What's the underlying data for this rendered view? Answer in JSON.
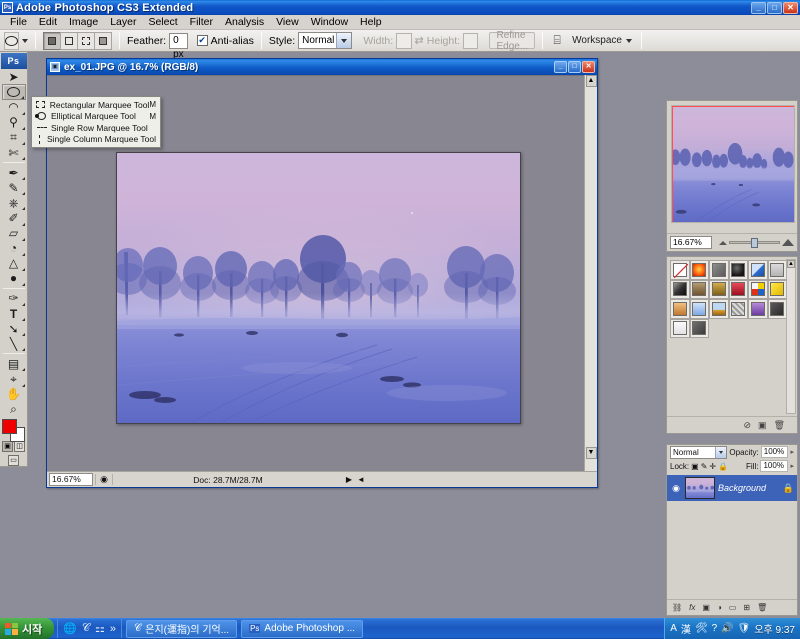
{
  "window": {
    "title": "Adobe Photoshop CS3 Extended",
    "app_icon": "photoshop-icon",
    "minimize": "_",
    "maximize": "□",
    "close": "✕"
  },
  "menubar": {
    "items": [
      {
        "label": "File"
      },
      {
        "label": "Edit"
      },
      {
        "label": "Image"
      },
      {
        "label": "Layer"
      },
      {
        "label": "Select"
      },
      {
        "label": "Filter"
      },
      {
        "label": "Analysis"
      },
      {
        "label": "View"
      },
      {
        "label": "Window"
      },
      {
        "label": "Help"
      }
    ]
  },
  "options_bar": {
    "tool_icon": "elliptical-marquee-icon",
    "selection_modes": [
      "new-selection",
      "add-to-selection",
      "subtract-from-selection",
      "intersect-selection"
    ],
    "feather_label": "Feather:",
    "feather_value": "0 px",
    "antialias_label": "Anti-alias",
    "antialias_checked": true,
    "style_label": "Style:",
    "style_value": "Normal",
    "width_label": "Width:",
    "width_value": "",
    "height_label": "Height:",
    "height_value": "",
    "swap_icon": "swap-dimensions-icon",
    "refine_edge_label": "Refine Edge...",
    "bridge_icon": "go-to-bridge-icon",
    "workspace_label": "Workspace"
  },
  "toolbox": {
    "logo": "Ps",
    "tools": [
      {
        "name": "move-tool",
        "glyph": "➤"
      },
      {
        "name": "marquee-tool",
        "glyph": "◯",
        "selected": true
      },
      {
        "name": "lasso-tool",
        "glyph": "⟓"
      },
      {
        "name": "magic-wand-tool",
        "glyph": "⚲"
      },
      {
        "name": "crop-tool",
        "glyph": "⌗"
      },
      {
        "name": "slice-tool",
        "glyph": "✂"
      },
      {
        "name": "healing-brush-tool",
        "glyph": "✒"
      },
      {
        "name": "brush-tool",
        "glyph": "🖌"
      },
      {
        "name": "clone-stamp-tool",
        "glyph": "⎙"
      },
      {
        "name": "history-brush-tool",
        "glyph": "✎"
      },
      {
        "name": "eraser-tool",
        "glyph": "▱"
      },
      {
        "name": "gradient-tool",
        "glyph": "◈"
      },
      {
        "name": "blur-tool",
        "glyph": "△"
      },
      {
        "name": "dodge-tool",
        "glyph": "●"
      },
      {
        "name": "pen-tool",
        "glyph": "✐"
      },
      {
        "name": "type-tool",
        "glyph": "T"
      },
      {
        "name": "path-selection-tool",
        "glyph": "➘"
      },
      {
        "name": "line-shape-tool",
        "glyph": "╲"
      },
      {
        "name": "notes-tool",
        "glyph": "▤"
      },
      {
        "name": "eyedropper-tool",
        "glyph": "⌖"
      },
      {
        "name": "hand-tool",
        "glyph": "✋"
      },
      {
        "name": "zoom-tool",
        "glyph": "⌕"
      }
    ],
    "foreground_color": "#ee0000",
    "background_color": "#ffffff",
    "quickmask_icons": [
      "standard-mode-icon",
      "quick-mask-mode-icon"
    ],
    "screenmode_icons": [
      "screen-mode-icon"
    ]
  },
  "flyout_menu": {
    "visible": true,
    "items": [
      {
        "label": "Rectangular Marquee Tool",
        "shortcut": "M",
        "icon": "rectangular-marquee-icon",
        "checked": false
      },
      {
        "label": "Elliptical Marquee Tool",
        "shortcut": "M",
        "icon": "elliptical-marquee-icon",
        "checked": true
      },
      {
        "label": "Single Row Marquee Tool",
        "shortcut": "",
        "icon": "single-row-marquee-icon",
        "checked": false
      },
      {
        "label": "Single Column Marquee Tool",
        "shortcut": "",
        "icon": "single-column-marquee-icon",
        "checked": false
      }
    ]
  },
  "document": {
    "title": "ex_01.JPG @ 16.7% (RGB/8)",
    "icon": "document-icon",
    "minimize": "_",
    "maximize": "□",
    "close": "✕",
    "status": {
      "zoom": "16.67%",
      "preview_icon": "preview-icon",
      "doc_info": "Doc: 28.7M/28.7M",
      "arrow": "▶",
      "resize": "◄"
    }
  },
  "navigator": {
    "name": "navigator-panel",
    "zoom_value": "16.67%",
    "zoom_out_icon": "zoom-out-icon",
    "zoom_in_icon": "zoom-in-icon",
    "view_box_color": "#ff4f4f"
  },
  "styles": {
    "name": "styles-panel",
    "swatches": [
      "#ffffff",
      "#ff4500",
      "#606060",
      "#2b2b2b",
      "#3f78d8",
      "#c9c9c9",
      "#3a3a3a",
      "#8a7050",
      "#9b8040",
      "#c02030",
      "#d8a820",
      "#f0d020",
      "#c08040",
      "#70a8e0",
      "#2060b0",
      "#d8d8d8",
      "#7040a0",
      "#404040",
      "#f0f0f0",
      "#505050"
    ],
    "footer_icons": [
      "clear-style-icon",
      "new-style-icon",
      "delete-style-icon"
    ]
  },
  "layers": {
    "name": "layers-panel",
    "blend_mode": "Normal",
    "opacity_label": "Opacity:",
    "opacity_value": "100%",
    "lock_label": "Lock:",
    "lock_icons": [
      "lock-transparency-icon",
      "lock-pixels-icon",
      "lock-position-icon",
      "lock-all-icon"
    ],
    "fill_label": "Fill:",
    "fill_value": "100%",
    "items": [
      {
        "name": "Background",
        "visible": true,
        "locked": true,
        "thumb": "landscape-thumbnail"
      }
    ],
    "footer_icons": [
      "link-layers-icon",
      "layer-style-fx-icon",
      "add-mask-icon",
      "adjustment-layer-icon",
      "new-group-icon",
      "new-layer-icon",
      "delete-layer-icon"
    ]
  },
  "taskbar": {
    "start_label": "시작",
    "start_icon": "windows-flag-icon",
    "quicklaunch": [
      "internet-explorer-icon",
      "browser-icon",
      "network-icon",
      "more-chevron-icon"
    ],
    "tasks": [
      {
        "label": "은지(運指)의 기억...",
        "icon": "browser-icon"
      },
      {
        "label": "Adobe Photoshop ...",
        "icon": "photoshop-icon"
      }
    ],
    "tray_icons": [
      "ime-alpha-icon",
      "ime-hanja-icon",
      "ime-tool-icon",
      "help-icon",
      "volume-icon",
      "shield-icon"
    ],
    "clock": "오후 9:37"
  }
}
